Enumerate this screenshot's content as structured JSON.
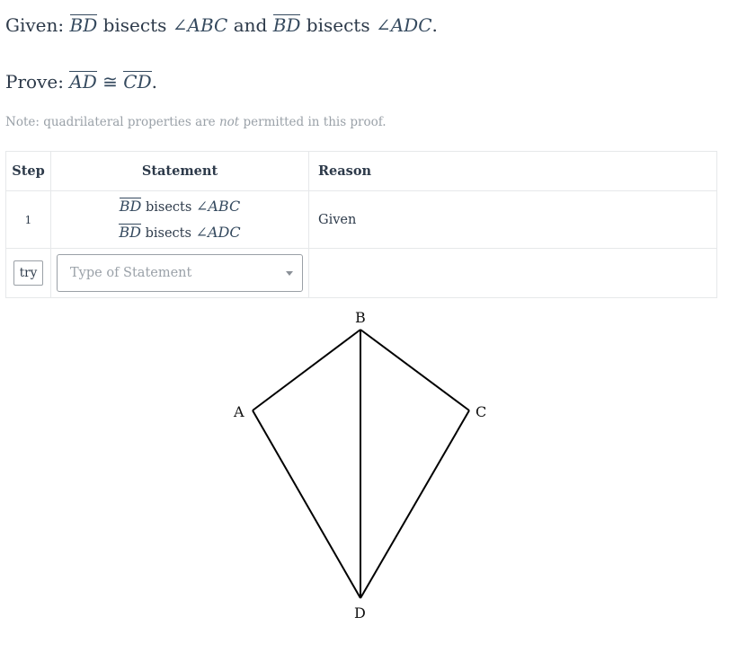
{
  "given": {
    "prefix": "Given:",
    "seg1": "BD",
    "bisects1": "bisects",
    "angle1": "ABC",
    "and": "and",
    "seg2": "BD",
    "bisects2": "bisects",
    "angle2": "ADC"
  },
  "prove": {
    "prefix": "Prove:",
    "seg1": "AD",
    "symbol": "≅",
    "seg2": "CD"
  },
  "note": {
    "before": "Note: quadrilateral properties are",
    "emphasis": "not",
    "after": "permitted in this proof."
  },
  "table": {
    "headers": {
      "step": "Step",
      "statement": "Statement",
      "reason": "Reason"
    },
    "rows": [
      {
        "step": "1",
        "statement": [
          {
            "segment": "BD",
            "verb": "bisects",
            "angle": "ABC"
          },
          {
            "segment": "BD",
            "verb": "bisects",
            "angle": "ADC"
          }
        ],
        "reason": "Given"
      }
    ],
    "input_row": {
      "try_label": "try",
      "select_placeholder": "Type of Statement"
    }
  },
  "figure": {
    "labels": {
      "A": "A",
      "B": "B",
      "C": "C",
      "D": "D"
    }
  }
}
